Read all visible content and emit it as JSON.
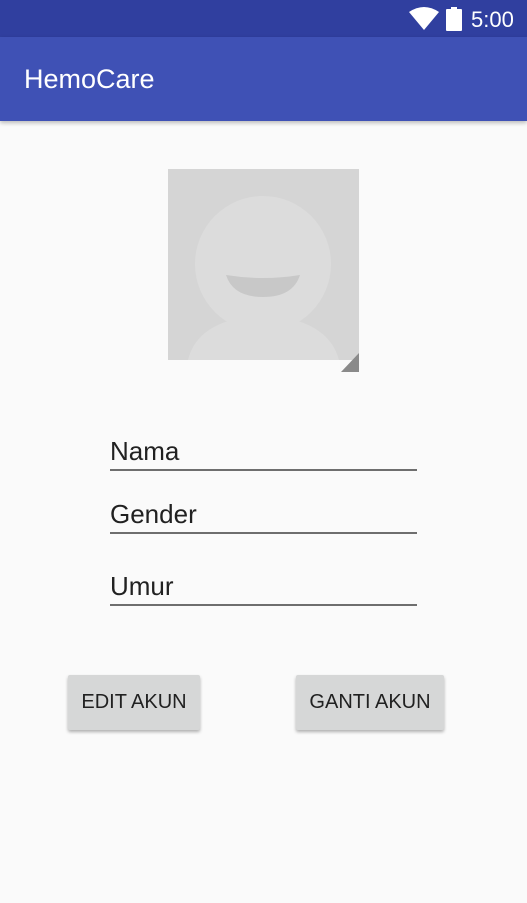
{
  "status_bar": {
    "time": "5:00",
    "icons": [
      "wifi-icon",
      "battery-icon"
    ]
  },
  "app_bar": {
    "title": "HemoCare"
  },
  "profile": {
    "avatar_icon": "default-avatar-icon",
    "fields": {
      "nama": "Nama",
      "gender": "Gender",
      "umur": "Umur"
    }
  },
  "actions": {
    "edit_label": "EDIT AKUN",
    "ganti_label": "GANTI AKUN"
  },
  "colors": {
    "status_bar": "#303f9f",
    "primary": "#3f51b5",
    "background": "#fafafa",
    "button": "#d6d7d7"
  }
}
